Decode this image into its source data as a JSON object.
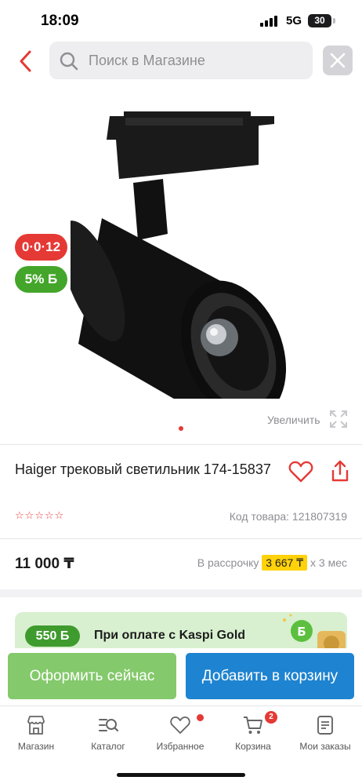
{
  "status_bar": {
    "time": "18:09",
    "network": "5G",
    "battery": "30"
  },
  "search": {
    "placeholder": "Поиск в Магазине"
  },
  "gallery": {
    "badge_installment": "0·0·12",
    "badge_bonus": "5% Б",
    "zoom_label": "Увеличить"
  },
  "product": {
    "title": "Haiger трековый светильник 174-15837",
    "rating_stars": 0,
    "sku_label": "Код товара:",
    "sku": "121807319",
    "price": "11 000 ₸",
    "installment_prefix": "В рассрочку",
    "installment_monthly": "3 667 ₸",
    "installment_suffix": "х 3 мес"
  },
  "promo": {
    "bonus": "550 Б",
    "text": "При оплате с Kaspi Gold"
  },
  "actions": {
    "order": "Оформить сейчас",
    "cart": "Добавить в корзину"
  },
  "tabs": [
    {
      "label": "Магазин",
      "icon": "store-icon"
    },
    {
      "label": "Каталог",
      "icon": "catalog-icon"
    },
    {
      "label": "Избранное",
      "icon": "heart-icon",
      "dot": true
    },
    {
      "label": "Корзина",
      "icon": "cart-icon",
      "count": "2"
    },
    {
      "label": "Мои заказы",
      "icon": "orders-icon"
    }
  ],
  "colors": {
    "accent_red": "#e53935",
    "green": "#84c96b",
    "blue": "#1e83d0",
    "yellow": "#ffd20a"
  }
}
